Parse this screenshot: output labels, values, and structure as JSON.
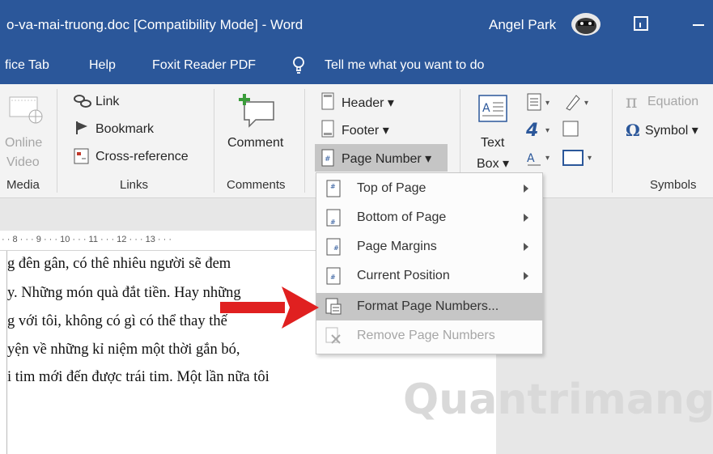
{
  "titlebar": {
    "title": "o-va-mai-truong.doc [Compatibility Mode]  -  Word",
    "user": "Angel Park"
  },
  "menubar": {
    "office_tab": "fice Tab",
    "help": "Help",
    "foxit": "Foxit Reader PDF",
    "tell_me": "Tell me what you want to do"
  },
  "ribbon": {
    "media": {
      "online": "Online",
      "video": "Video",
      "label": "Media"
    },
    "links": {
      "link": "Link",
      "bookmark": "Bookmark",
      "cross_reference": "Cross-reference",
      "label": "Links"
    },
    "comments": {
      "comment": "Comment",
      "label": "Comments"
    },
    "header_footer": {
      "header": "Header",
      "footer": "Footer",
      "page_number": "Page Number"
    },
    "text": {
      "text_box_line1": "Text",
      "text_box_line2": "Box",
      "label_fragment": "t"
    },
    "symbols": {
      "equation": "Equation",
      "symbol": "Symbol",
      "label": "Symbols"
    }
  },
  "ruler": {
    "ticks": [
      "· · 8 · · · 9 · · · 10 · · · 11 · · · 12 · · · 13 · · · "
    ]
  },
  "document": {
    "lines": [
      "g đên gân, có thê nhiêu người sẽ đem",
      "y. Những món quà đắt tiền. Hay những",
      "g với tôi, không có gì có thể thay thế",
      "yện về những kỉ niệm một thời gắn bó,",
      "i tim mới đến được trái tim. Một lần nữa tôi"
    ]
  },
  "page_number_menu": {
    "items": [
      {
        "label": "Top of Page",
        "icon": "page-top-icon",
        "submenu": true,
        "disabled": false
      },
      {
        "label": "Bottom of Page",
        "icon": "page-bottom-icon",
        "submenu": true,
        "disabled": false
      },
      {
        "label": "Page Margins",
        "icon": "page-margins-icon",
        "submenu": true,
        "disabled": false
      },
      {
        "label": "Current Position",
        "icon": "current-position-icon",
        "submenu": true,
        "disabled": false
      },
      {
        "label": "Format Page Numbers...",
        "icon": "format-page-numbers-icon",
        "submenu": false,
        "disabled": false
      },
      {
        "label": "Remove Page Numbers",
        "icon": "remove-page-numbers-icon",
        "submenu": false,
        "disabled": true
      }
    ]
  },
  "watermark": "Quantrimang",
  "colors": {
    "title_bar": "#2b579a",
    "ribbon": "#f3f3f3",
    "highlight": "#c6c6c6",
    "annotation_arrow": "#e02020"
  }
}
